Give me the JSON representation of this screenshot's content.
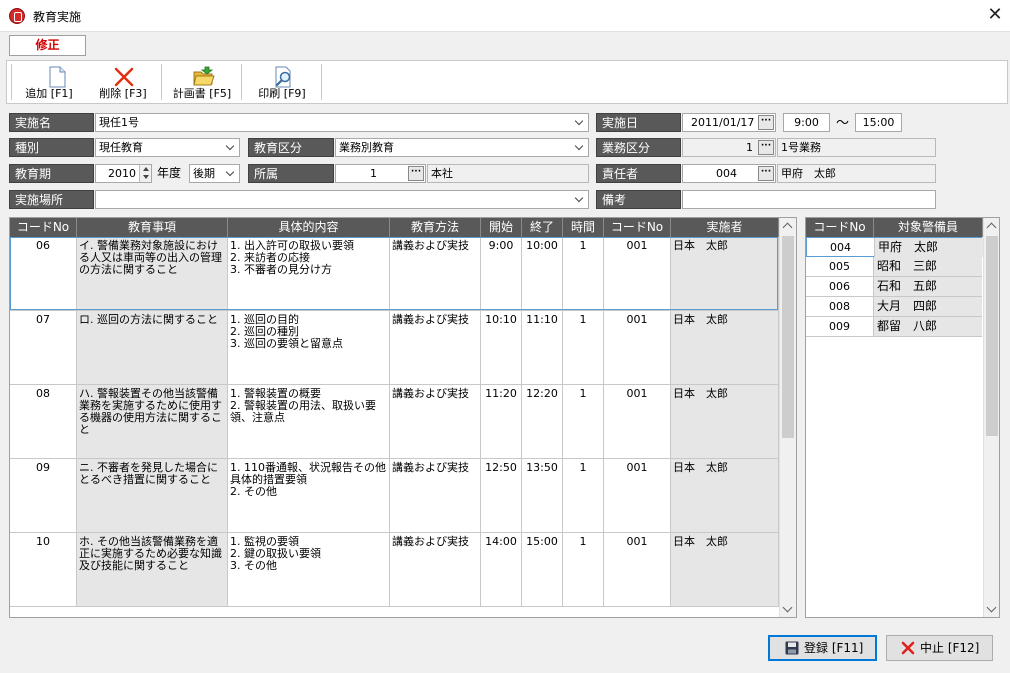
{
  "window": {
    "title": "教育実施",
    "close_glyph": "✕"
  },
  "mode_badge": "修正",
  "toolbar": [
    {
      "label": "追加 [F1]",
      "icon": "new-page-icon"
    },
    {
      "label": "削除 [F3]",
      "icon": "delete-x-icon"
    },
    {
      "label": "計画書 [F5]",
      "icon": "open-folder-icon"
    },
    {
      "label": "印刷 [F9]",
      "icon": "print-preview-icon"
    }
  ],
  "form": {
    "jisshi_mei": {
      "label": "実施名",
      "value": "現任1号"
    },
    "jisshi_bi": {
      "label": "実施日",
      "date": "2011/01/17",
      "start": "9:00",
      "tilde": "～",
      "end": "15:00"
    },
    "shubetsu": {
      "label": "種別",
      "value": "現任教育"
    },
    "kyoiku_kubun": {
      "label": "教育区分",
      "value": "業務別教育"
    },
    "gyomu_kubun": {
      "label": "業務区分",
      "code": "1",
      "name": "1号業務"
    },
    "kyoiku_ki": {
      "label": "教育期",
      "year": "2010",
      "year_unit": "年度",
      "term": "後期"
    },
    "shozoku": {
      "label": "所属",
      "code": "1",
      "name": "本社"
    },
    "sekininsha": {
      "label": "責任者",
      "code": "004",
      "name": "甲府　太郎"
    },
    "jisshi_basho": {
      "label": "実施場所",
      "value": ""
    },
    "biko": {
      "label": "備考",
      "value": ""
    },
    "ellipsis": "···"
  },
  "main_grid": {
    "headers": [
      "コードNo",
      "教育事項",
      "具体的内容",
      "教育方法",
      "開始",
      "終了",
      "時間",
      "コードNo",
      "実施者"
    ],
    "rows": [
      {
        "code": "06",
        "item": "イ. 警備業務対象施設における人又は車両等の出入の管理の方法に関すること",
        "details": [
          "1. 出入許可の取扱い要領",
          "2. 来訪者の応接",
          "3. 不審者の見分け方"
        ],
        "method": "講義および実技",
        "start": "9:00",
        "end": "10:00",
        "hours": "1",
        "inst_code": "001",
        "instructor": "日本　太郎"
      },
      {
        "code": "07",
        "item": "ロ. 巡回の方法に関すること",
        "details": [
          "1. 巡回の目的",
          "2. 巡回の種別",
          "3. 巡回の要領と留意点"
        ],
        "method": "講義および実技",
        "start": "10:10",
        "end": "11:10",
        "hours": "1",
        "inst_code": "001",
        "instructor": "日本　太郎"
      },
      {
        "code": "08",
        "item": "ハ. 警報装置その他当該警備業務を実施するために使用する機器の使用方法に関すること",
        "details": [
          "1. 警報装置の概要",
          "2. 警報装置の用法、取扱い要領、注意点"
        ],
        "method": "講義および実技",
        "start": "11:20",
        "end": "12:20",
        "hours": "1",
        "inst_code": "001",
        "instructor": "日本　太郎"
      },
      {
        "code": "09",
        "item": "ニ. 不審者を発見した場合にとるべき措置に関すること",
        "details": [
          "1. 110番通報、状況報告その他具体的措置要領",
          "2. その他"
        ],
        "method": "講義および実技",
        "start": "12:50",
        "end": "13:50",
        "hours": "1",
        "inst_code": "001",
        "instructor": "日本　太郎"
      },
      {
        "code": "10",
        "item": "ホ. その他当該警備業務を適正に実施するため必要な知識及び技能に関すること",
        "details": [
          "1. 監視の要領",
          "2. 鍵の取扱い要領",
          "3. その他"
        ],
        "method": "講義および実技",
        "start": "14:00",
        "end": "15:00",
        "hours": "1",
        "inst_code": "001",
        "instructor": "日本　太郎"
      }
    ]
  },
  "side_grid": {
    "headers": [
      "コードNo",
      "対象警備員"
    ],
    "rows": [
      {
        "code": "004",
        "name": "甲府　太郎"
      },
      {
        "code": "005",
        "name": "昭和　三郎"
      },
      {
        "code": "006",
        "name": "石和　五郎"
      },
      {
        "code": "008",
        "name": "大月　四郎"
      },
      {
        "code": "009",
        "name": "都留　八郎"
      }
    ]
  },
  "buttons": {
    "register": "登録 [F11]",
    "cancel": "中止 [F12]"
  },
  "colors": {
    "label_bg": "#595959",
    "shade": "#e6e6e6",
    "select_border": "#5a9ad5",
    "badge_text": "#d40000"
  }
}
